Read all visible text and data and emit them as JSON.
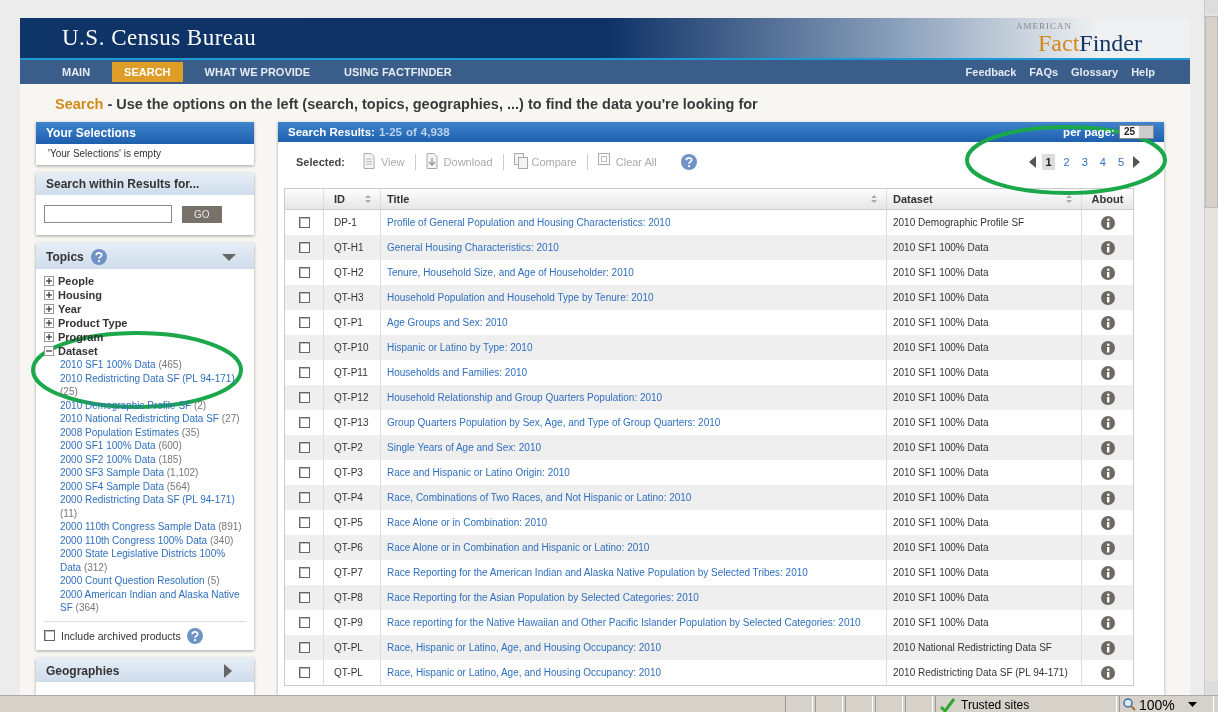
{
  "header": {
    "agency": "U.S. Census Bureau",
    "logo_top": "AMERICAN",
    "logo_left": "Fact",
    "logo_right": "Finder"
  },
  "nav": {
    "tabs": [
      {
        "label": "MAIN",
        "selected": false
      },
      {
        "label": "SEARCH",
        "selected": true
      },
      {
        "label": "WHAT WE PROVIDE",
        "selected": false
      },
      {
        "label": "USING FACTFINDER",
        "selected": false
      }
    ],
    "links": [
      "Feedback",
      "FAQs",
      "Glossary",
      "Help"
    ]
  },
  "heading": {
    "lead": "Search",
    "text": "- Use the options on the left (search, topics, geographies, ...) to find the data you're looking for"
  },
  "selections": {
    "title": "Your Selections",
    "note": "'Your Selections' is empty"
  },
  "search_within": {
    "title": "Search within Results for...",
    "button": "GO"
  },
  "topics": {
    "title": "Topics",
    "items": [
      {
        "label": "People",
        "expanded": false
      },
      {
        "label": "Housing",
        "expanded": false
      },
      {
        "label": "Year",
        "expanded": false
      },
      {
        "label": "Product Type",
        "expanded": false
      },
      {
        "label": "Program",
        "expanded": false
      },
      {
        "label": "Dataset",
        "expanded": true,
        "children": [
          {
            "label": "2010 SF1 100% Data",
            "count": "(465)"
          },
          {
            "label": "2010 Redistricting Data SF (PL 94-171)",
            "count": "(25)"
          },
          {
            "label": "2010 Demographic Profile SF",
            "count": "(2)"
          },
          {
            "label": "2010 National Redistricting Data SF",
            "count": "(27)"
          },
          {
            "label": "2008 Population Estimates",
            "count": "(35)"
          },
          {
            "label": "2000 SF1 100% Data",
            "count": "(600)"
          },
          {
            "label": "2000 SF2 100% Data",
            "count": "(185)"
          },
          {
            "label": "2000 SF3 Sample Data",
            "count": "(1,102)"
          },
          {
            "label": "2000 SF4 Sample Data",
            "count": "(564)"
          },
          {
            "label": "2000 Redistricting Data SF (PL 94-171)",
            "count": "(11)"
          },
          {
            "label": "2000 110th Congress Sample Data",
            "count": "(891)"
          },
          {
            "label": "2000 110th Congress 100% Data",
            "count": "(340)"
          },
          {
            "label": "2000 State Legislative Districts 100% Data",
            "count": "(312)"
          },
          {
            "label": "2000 Count Question Resolution",
            "count": "(5)"
          },
          {
            "label": "2000 American Indian and Alaska Native SF",
            "count": "(364)"
          }
        ]
      }
    ],
    "archived": {
      "label": "Include archived products",
      "checked": false
    }
  },
  "geographies": {
    "title": "Geographies"
  },
  "results": {
    "title": "Search Results:",
    "range": "1-25",
    "of": "of",
    "total": "4,938",
    "per_page_label": "per page:",
    "per_page": "25",
    "selected_label": "Selected:",
    "actions": [
      {
        "kind": "view",
        "label": "View",
        "disabled": true
      },
      {
        "kind": "download",
        "label": "Download",
        "disabled": true
      },
      {
        "kind": "compare",
        "label": "Compare",
        "disabled": true
      },
      {
        "kind": "clear",
        "label": "Clear All",
        "disabled": true
      }
    ],
    "pages": [
      {
        "label": "1",
        "selected": true
      },
      {
        "label": "2",
        "selected": false
      },
      {
        "label": "3",
        "selected": false
      },
      {
        "label": "4",
        "selected": false
      },
      {
        "label": "5",
        "selected": false
      }
    ],
    "columns": [
      {
        "label": "ID",
        "sortable": true
      },
      {
        "label": "Title",
        "sortable": true
      },
      {
        "label": "Dataset",
        "sortable": true
      },
      {
        "label": "About",
        "sortable": false
      }
    ],
    "rows": [
      {
        "checked": false,
        "id": "DP-1",
        "title": "Profile of General Population and Housing Characteristics: 2010",
        "dataset": "2010 Demographic Profile SF"
      },
      {
        "checked": false,
        "id": "QT-H1",
        "title": "General Housing Characteristics: 2010",
        "dataset": "2010 SF1 100% Data"
      },
      {
        "checked": false,
        "id": "QT-H2",
        "title": "Tenure, Household Size, and Age of Householder: 2010",
        "dataset": "2010 SF1 100% Data"
      },
      {
        "checked": false,
        "id": "QT-H3",
        "title": "Household Population and Household Type by Tenure: 2010",
        "dataset": "2010 SF1 100% Data"
      },
      {
        "checked": false,
        "id": "QT-P1",
        "title": "Age Groups and Sex: 2010",
        "dataset": "2010 SF1 100% Data"
      },
      {
        "checked": false,
        "id": "QT-P10",
        "title": "Hispanic or Latino by Type: 2010",
        "dataset": "2010 SF1 100% Data"
      },
      {
        "checked": false,
        "id": "QT-P11",
        "title": "Households and Families: 2010",
        "dataset": "2010 SF1 100% Data"
      },
      {
        "checked": false,
        "id": "QT-P12",
        "title": "Household Relationship and Group Quarters Population: 2010",
        "dataset": "2010 SF1 100% Data"
      },
      {
        "checked": false,
        "id": "QT-P13",
        "title": "Group Quarters Population by Sex, Age, and Type of Group Quarters: 2010",
        "dataset": "2010 SF1 100% Data"
      },
      {
        "checked": false,
        "id": "QT-P2",
        "title": "Single Years of Age and Sex: 2010",
        "dataset": "2010 SF1 100% Data"
      },
      {
        "checked": false,
        "id": "QT-P3",
        "title": "Race and Hispanic or Latino Origin: 2010",
        "dataset": "2010 SF1 100% Data"
      },
      {
        "checked": false,
        "id": "QT-P4",
        "title": "Race, Combinations of Two Races, and Not Hispanic or Latino: 2010",
        "dataset": "2010 SF1 100% Data"
      },
      {
        "checked": false,
        "id": "QT-P5",
        "title": "Race Alone or in Combination: 2010",
        "dataset": "2010 SF1 100% Data"
      },
      {
        "checked": false,
        "id": "QT-P6",
        "title": "Race Alone or in Combination and Hispanic or Latino: 2010",
        "dataset": "2010 SF1 100% Data"
      },
      {
        "checked": false,
        "id": "QT-P7",
        "title": "Race Reporting for the American Indian and Alaska Native Population by Selected Tribes: 2010",
        "dataset": "2010 SF1 100% Data"
      },
      {
        "checked": false,
        "id": "QT-P8",
        "title": "Race Reporting for the Asian Population by Selected Categories: 2010",
        "dataset": "2010 SF1 100% Data"
      },
      {
        "checked": false,
        "id": "QT-P9",
        "title": "Race reporting for the Native Hawaiian and Other Pacific Islander Population by Selected Categories: 2010",
        "dataset": "2010 SF1 100% Data"
      },
      {
        "checked": false,
        "id": "QT-PL",
        "title": "Race, Hispanic or Latino, Age, and Housing Occupancy: 2010",
        "dataset": "2010 National Redistricting Data SF"
      },
      {
        "checked": false,
        "id": "QT-PL",
        "title": "Race, Hispanic or Latino, Age, and Housing Occupancy: 2010",
        "dataset": "2010 Redistricting Data SF (PL 94-171)"
      }
    ]
  },
  "status_bar": {
    "zone": "Trusted sites",
    "zoom": "100%"
  }
}
